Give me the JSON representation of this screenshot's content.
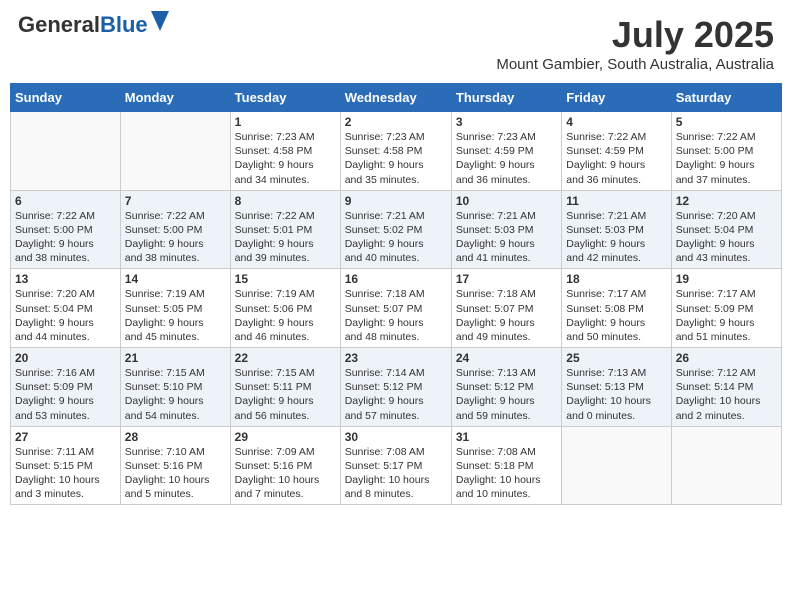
{
  "header": {
    "logo_general": "General",
    "logo_blue": "Blue",
    "month_year": "July 2025",
    "location": "Mount Gambier, South Australia, Australia"
  },
  "days_of_week": [
    "Sunday",
    "Monday",
    "Tuesday",
    "Wednesday",
    "Thursday",
    "Friday",
    "Saturday"
  ],
  "weeks": [
    [
      {
        "day": "",
        "info": ""
      },
      {
        "day": "",
        "info": ""
      },
      {
        "day": "1",
        "info": "Sunrise: 7:23 AM\nSunset: 4:58 PM\nDaylight: 9 hours\nand 34 minutes."
      },
      {
        "day": "2",
        "info": "Sunrise: 7:23 AM\nSunset: 4:58 PM\nDaylight: 9 hours\nand 35 minutes."
      },
      {
        "day": "3",
        "info": "Sunrise: 7:23 AM\nSunset: 4:59 PM\nDaylight: 9 hours\nand 36 minutes."
      },
      {
        "day": "4",
        "info": "Sunrise: 7:22 AM\nSunset: 4:59 PM\nDaylight: 9 hours\nand 36 minutes."
      },
      {
        "day": "5",
        "info": "Sunrise: 7:22 AM\nSunset: 5:00 PM\nDaylight: 9 hours\nand 37 minutes."
      }
    ],
    [
      {
        "day": "6",
        "info": "Sunrise: 7:22 AM\nSunset: 5:00 PM\nDaylight: 9 hours\nand 38 minutes."
      },
      {
        "day": "7",
        "info": "Sunrise: 7:22 AM\nSunset: 5:00 PM\nDaylight: 9 hours\nand 38 minutes."
      },
      {
        "day": "8",
        "info": "Sunrise: 7:22 AM\nSunset: 5:01 PM\nDaylight: 9 hours\nand 39 minutes."
      },
      {
        "day": "9",
        "info": "Sunrise: 7:21 AM\nSunset: 5:02 PM\nDaylight: 9 hours\nand 40 minutes."
      },
      {
        "day": "10",
        "info": "Sunrise: 7:21 AM\nSunset: 5:03 PM\nDaylight: 9 hours\nand 41 minutes."
      },
      {
        "day": "11",
        "info": "Sunrise: 7:21 AM\nSunset: 5:03 PM\nDaylight: 9 hours\nand 42 minutes."
      },
      {
        "day": "12",
        "info": "Sunrise: 7:20 AM\nSunset: 5:04 PM\nDaylight: 9 hours\nand 43 minutes."
      }
    ],
    [
      {
        "day": "13",
        "info": "Sunrise: 7:20 AM\nSunset: 5:04 PM\nDaylight: 9 hours\nand 44 minutes."
      },
      {
        "day": "14",
        "info": "Sunrise: 7:19 AM\nSunset: 5:05 PM\nDaylight: 9 hours\nand 45 minutes."
      },
      {
        "day": "15",
        "info": "Sunrise: 7:19 AM\nSunset: 5:06 PM\nDaylight: 9 hours\nand 46 minutes."
      },
      {
        "day": "16",
        "info": "Sunrise: 7:18 AM\nSunset: 5:07 PM\nDaylight: 9 hours\nand 48 minutes."
      },
      {
        "day": "17",
        "info": "Sunrise: 7:18 AM\nSunset: 5:07 PM\nDaylight: 9 hours\nand 49 minutes."
      },
      {
        "day": "18",
        "info": "Sunrise: 7:17 AM\nSunset: 5:08 PM\nDaylight: 9 hours\nand 50 minutes."
      },
      {
        "day": "19",
        "info": "Sunrise: 7:17 AM\nSunset: 5:09 PM\nDaylight: 9 hours\nand 51 minutes."
      }
    ],
    [
      {
        "day": "20",
        "info": "Sunrise: 7:16 AM\nSunset: 5:09 PM\nDaylight: 9 hours\nand 53 minutes."
      },
      {
        "day": "21",
        "info": "Sunrise: 7:15 AM\nSunset: 5:10 PM\nDaylight: 9 hours\nand 54 minutes."
      },
      {
        "day": "22",
        "info": "Sunrise: 7:15 AM\nSunset: 5:11 PM\nDaylight: 9 hours\nand 56 minutes."
      },
      {
        "day": "23",
        "info": "Sunrise: 7:14 AM\nSunset: 5:12 PM\nDaylight: 9 hours\nand 57 minutes."
      },
      {
        "day": "24",
        "info": "Sunrise: 7:13 AM\nSunset: 5:12 PM\nDaylight: 9 hours\nand 59 minutes."
      },
      {
        "day": "25",
        "info": "Sunrise: 7:13 AM\nSunset: 5:13 PM\nDaylight: 10 hours\nand 0 minutes."
      },
      {
        "day": "26",
        "info": "Sunrise: 7:12 AM\nSunset: 5:14 PM\nDaylight: 10 hours\nand 2 minutes."
      }
    ],
    [
      {
        "day": "27",
        "info": "Sunrise: 7:11 AM\nSunset: 5:15 PM\nDaylight: 10 hours\nand 3 minutes."
      },
      {
        "day": "28",
        "info": "Sunrise: 7:10 AM\nSunset: 5:16 PM\nDaylight: 10 hours\nand 5 minutes."
      },
      {
        "day": "29",
        "info": "Sunrise: 7:09 AM\nSunset: 5:16 PM\nDaylight: 10 hours\nand 7 minutes."
      },
      {
        "day": "30",
        "info": "Sunrise: 7:08 AM\nSunset: 5:17 PM\nDaylight: 10 hours\nand 8 minutes."
      },
      {
        "day": "31",
        "info": "Sunrise: 7:08 AM\nSunset: 5:18 PM\nDaylight: 10 hours\nand 10 minutes."
      },
      {
        "day": "",
        "info": ""
      },
      {
        "day": "",
        "info": ""
      }
    ]
  ]
}
